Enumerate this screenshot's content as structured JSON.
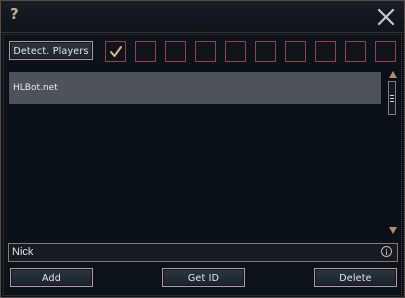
{
  "title_bar": {
    "help_symbol": "?",
    "close_icon": "close-x-icon"
  },
  "toolbar": {
    "detect_label": "Detect. Players"
  },
  "checkboxes": [
    {
      "checked": true
    },
    {
      "checked": false
    },
    {
      "checked": false
    },
    {
      "checked": false
    },
    {
      "checked": false
    },
    {
      "checked": false
    },
    {
      "checked": false
    },
    {
      "checked": false
    },
    {
      "checked": false
    },
    {
      "checked": false
    }
  ],
  "list": {
    "items": [
      "HLBot.net"
    ]
  },
  "nick_field": {
    "value": "Nick",
    "info_symbol": "i"
  },
  "buttons": {
    "add": "Add",
    "get_id": "Get ID",
    "delete": "Delete"
  },
  "colors": {
    "accent_border": "#b99796",
    "checkbox_border": "#9b3f45",
    "check_mark": "#d7b58e",
    "scroll_arrow": "#b98c63",
    "selected_row": "#4e5359"
  }
}
